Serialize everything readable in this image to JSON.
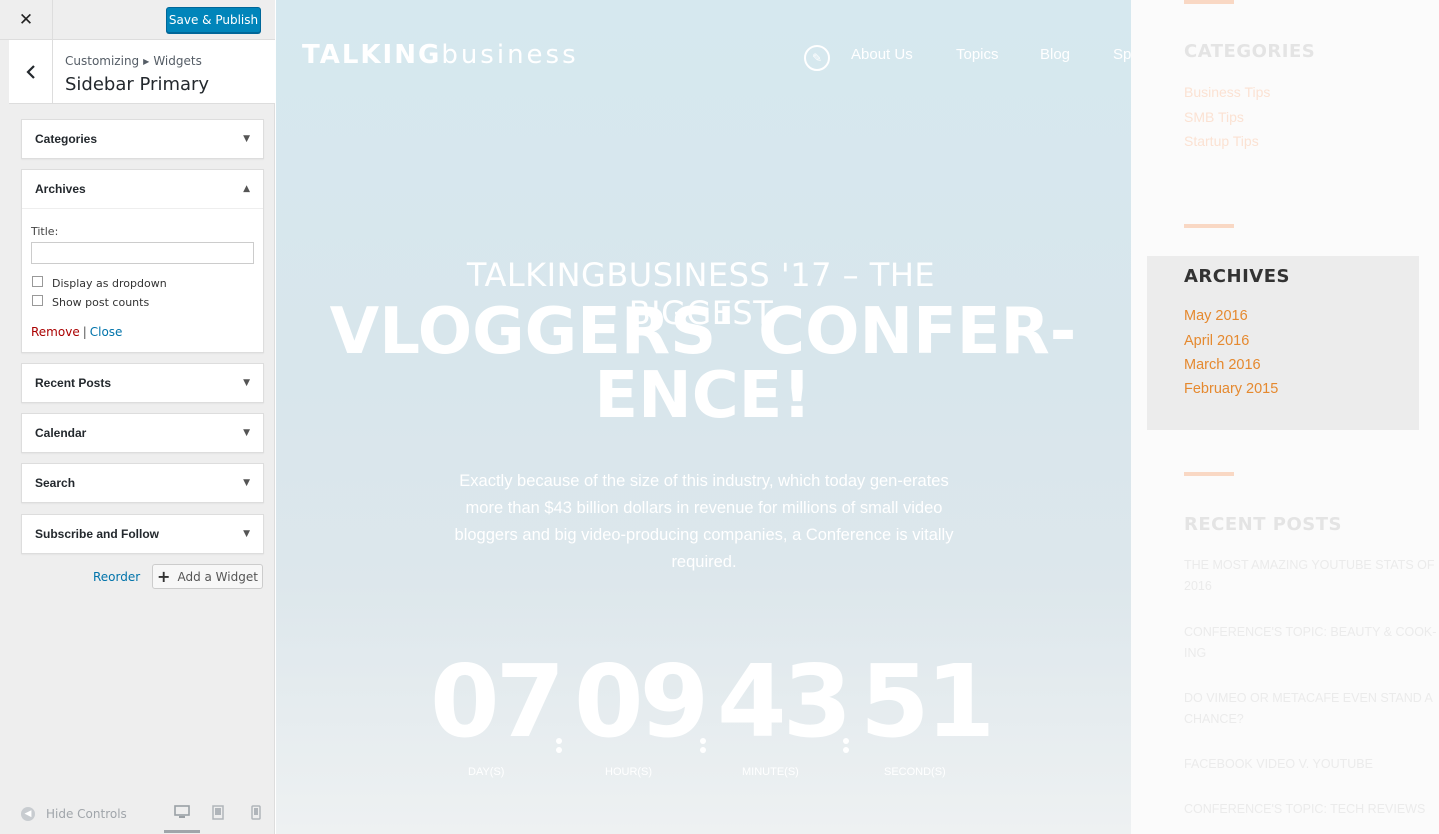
{
  "customizer": {
    "close_icon": "close-icon",
    "save_label": "Save & Publish",
    "breadcrumb": [
      "Customizing",
      "Widgets"
    ],
    "section_title": "Sidebar Primary",
    "widgets": [
      {
        "name": "Categories",
        "expanded": false
      },
      {
        "name": "Archives",
        "expanded": true
      },
      {
        "name": "Recent Posts",
        "expanded": false
      },
      {
        "name": "Calendar",
        "expanded": false
      },
      {
        "name": "Search",
        "expanded": false
      },
      {
        "name": "Subscribe and Follow",
        "expanded": false
      }
    ],
    "archives_form": {
      "title_label": "Title:",
      "title_value": "",
      "dropdown_label": "Display as dropdown",
      "dropdown_checked": false,
      "counts_label": "Show post counts",
      "counts_checked": false,
      "remove_label": "Remove",
      "separator": "|",
      "close_label": "Close"
    },
    "reorder_label": "Reorder",
    "add_widget_label": "Add a Widget",
    "hide_controls_label": "Hide Controls",
    "devices": [
      "desktop-icon",
      "tablet-icon",
      "mobile-icon"
    ],
    "active_device": "desktop"
  },
  "preview": {
    "logo_bold": "TALKING",
    "logo_light": "business",
    "nav": [
      "About Us",
      "Topics",
      "Blog",
      "Sp"
    ],
    "hero_subtitle": "TALKINGBUSINESS '17 – THE BIGGEST",
    "hero_title_line1": "VLOGGERS' CONFER-",
    "hero_title_line2": "ENCE!",
    "hero_description": "Exactly because of the size of this industry, which today gen-erates more than $43 billion dollars in revenue for millions of small video bloggers and big video-producing companies, a Conference is vitally required.",
    "countdown": {
      "days": "07",
      "hours": "09",
      "minutes": "43",
      "seconds": "51",
      "days_label": "DAY(S)",
      "hours_label": "HOUR(S)",
      "minutes_label": "MINUTE(S)",
      "seconds_label": "SECOND(S)"
    },
    "sidebar": {
      "categories_title": "CATEGORIES",
      "categories": [
        "Business Tips",
        "SMB Tips",
        "Startup Tips"
      ],
      "archives_title": "ARCHIVES",
      "archives": [
        "May 2016",
        "April 2016",
        "March 2016",
        "February 2015"
      ],
      "recent_title": "RECENT POSTS",
      "recent_posts": [
        "THE MOST AMAZING YOUTUBE STATS OF 2016",
        "CONFERENCE'S TOPIC: BEAUTY & COOK-ING",
        "DO VIMEO OR METACAFE EVEN STAND A CHANCE?",
        "FACEBOOK VIDEO V. YOUTUBE",
        "CONFERENCE'S TOPIC: TECH REVIEWS"
      ]
    },
    "colors": {
      "accent_orange": "#e5892f",
      "button_blue": "#0085ba"
    }
  }
}
